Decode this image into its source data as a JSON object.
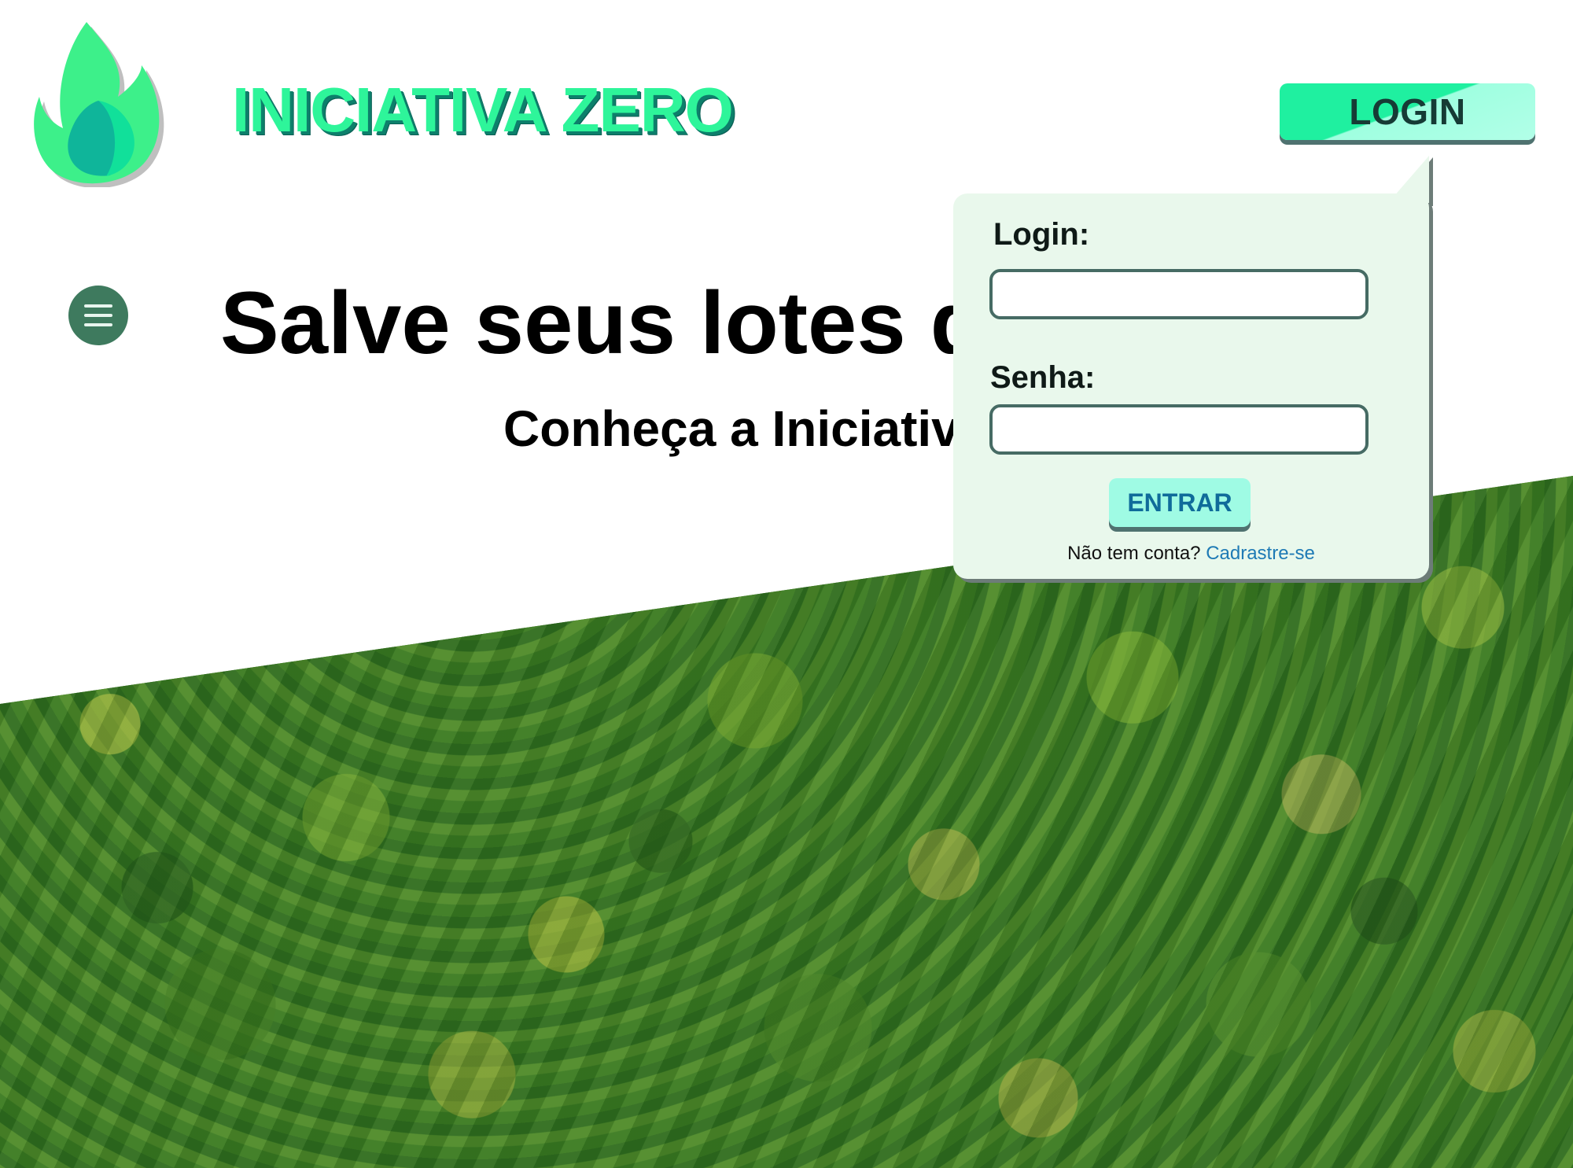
{
  "header": {
    "brand_name": "INICIATIVA ZERO",
    "login_button": "LOGIN"
  },
  "hero": {
    "headline": "Salve seus lotes d",
    "subheadline": "Conheça a Iniciativ"
  },
  "login_popover": {
    "login_label": "Login:",
    "login_value": "",
    "password_label": "Senha:",
    "password_value": "",
    "submit_label": "ENTRAR",
    "signup_prompt": "Não tem conta?",
    "signup_link": "Cadrastre-se"
  },
  "icons": {
    "logo": "flame-leaf-logo-icon",
    "menu": "hamburger-menu-icon"
  },
  "colors": {
    "brand_green": "#2ef59a",
    "brand_shadow": "#0d7f6b",
    "menu_button": "#3e7a5e",
    "popover_bg": "#e9f8ec",
    "link": "#1e7ab5"
  }
}
